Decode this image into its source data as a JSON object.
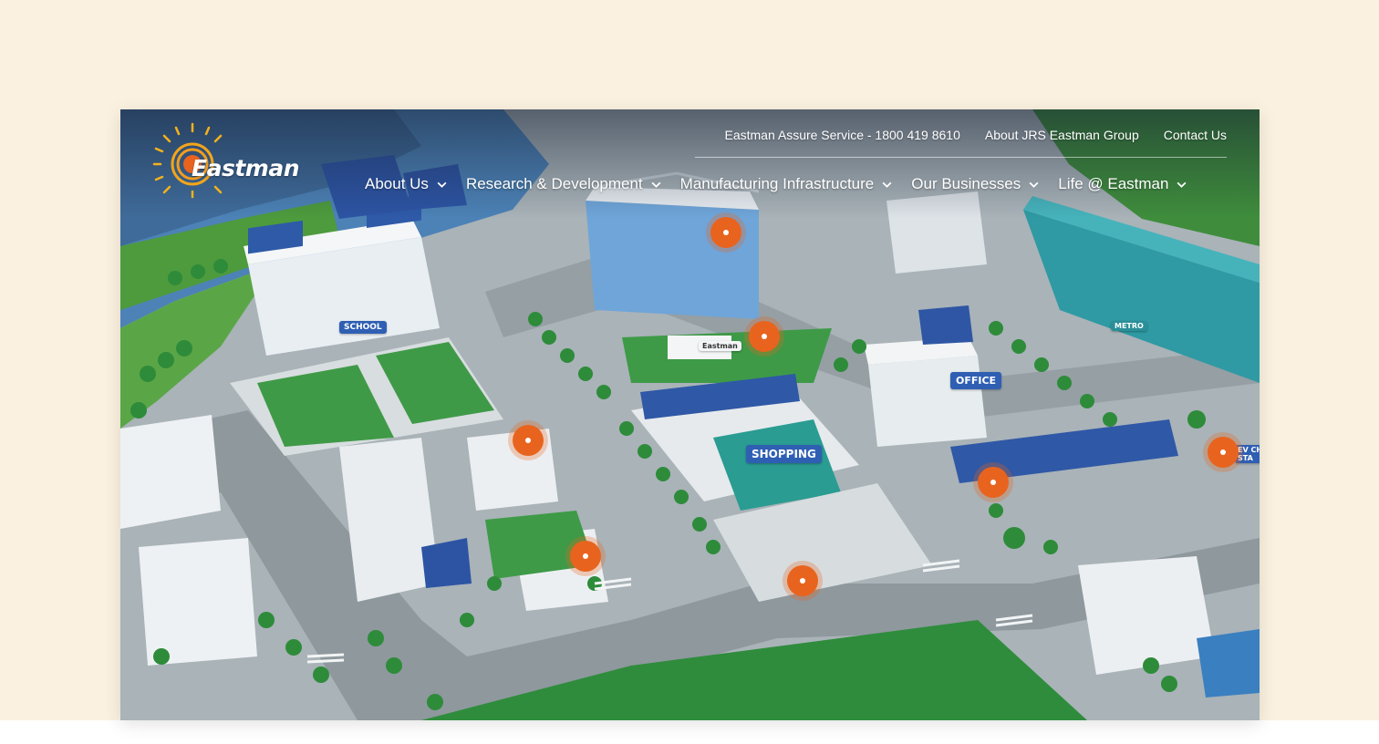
{
  "brand": {
    "logo_text": "Eastman"
  },
  "utility_nav": [
    {
      "label": "Eastman Assure Service - 1800 419 8610"
    },
    {
      "label": "About JRS Eastman Group"
    },
    {
      "label": "Contact Us"
    }
  ],
  "main_nav": [
    {
      "label": "About Us"
    },
    {
      "label": "Research & Development"
    },
    {
      "label": "Manufacturing Infrastructure"
    },
    {
      "label": "Our Businesses"
    },
    {
      "label": "Life @ Eastman"
    }
  ],
  "scene_signs": {
    "school": "SCHOOL",
    "office": "OFFICE",
    "shopping": "SHOPPING",
    "metro": "METRO",
    "ev": "EV CH STA",
    "building_logo": "Eastman"
  },
  "colors": {
    "accent": "#e8641e",
    "page_bg": "#fbf1e0",
    "sign_blue": "#2f5fb3"
  }
}
